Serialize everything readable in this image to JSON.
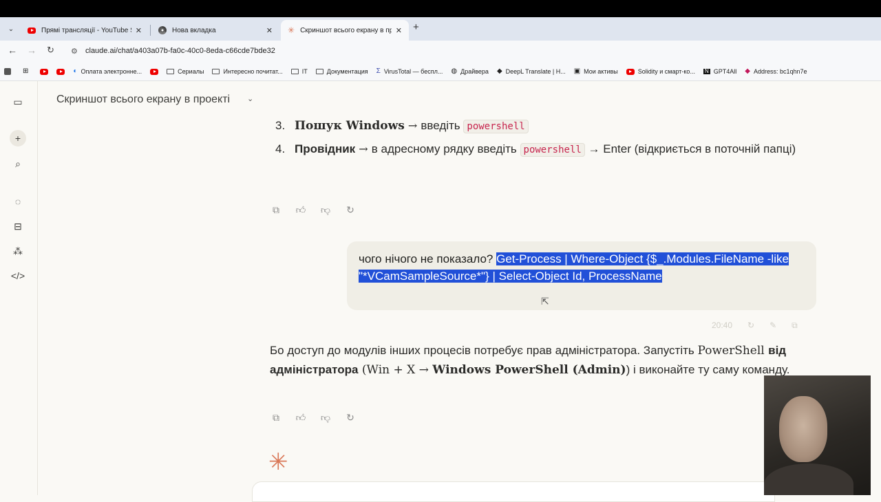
{
  "browser": {
    "tabs": [
      {
        "title": "Прямі трансляції - YouTube Stu",
        "icon": "youtube-icon"
      },
      {
        "title": "Нова вкладка",
        "icon": "chrome-icon"
      },
      {
        "title": "Скриншот всього екрану в пр",
        "icon": "claude-icon"
      }
    ],
    "url": "claude.ai/chat/a403a07b-fa0c-40c0-8eda-c66cde7bde32",
    "bookmarks": [
      {
        "label": "",
        "icon": "youtube-icon"
      },
      {
        "label": "",
        "icon": "youtube-icon"
      },
      {
        "label": "Оплата электронне...",
        "icon": "edge-icon"
      },
      {
        "label": "",
        "icon": "youtube-icon"
      },
      {
        "label": "Сериалы",
        "icon": "folder-icon"
      },
      {
        "label": "Интересно почитат...",
        "icon": "folder-icon"
      },
      {
        "label": "IT",
        "icon": "folder-icon"
      },
      {
        "label": "Документация",
        "icon": "folder-icon"
      },
      {
        "label": "VirusTotal — беспл...",
        "icon": "virustotal-icon"
      },
      {
        "label": "Драйвера",
        "icon": "globe-icon"
      },
      {
        "label": "DeepL Translate | H...",
        "icon": "deepl-icon"
      },
      {
        "label": "Мои активы",
        "icon": "grid-icon"
      },
      {
        "label": "Solidity и смарт-ко...",
        "icon": "youtube-icon"
      },
      {
        "label": "GPT4All",
        "icon": "n-icon"
      },
      {
        "label": "Address: bc1qhn7e",
        "icon": "gem-icon"
      }
    ]
  },
  "project": {
    "title": "Скриншот всього екрану в проекті"
  },
  "list": [
    {
      "num": "3.",
      "bold": "Пошук Windows",
      "arrow": " → ",
      "text": "введіть ",
      "code": "powershell"
    },
    {
      "num": "4.",
      "bold": "Провідник",
      "arrow": " → ",
      "text": "в адресному рядку введіть ",
      "code": "powershell",
      "after": " → Enter (відкриється в поточній папці)"
    }
  ],
  "user_message": {
    "plain": "чого нічого не показало? ",
    "selected": "Get-Process | Where-Object {$_.Modules.FileName -like \"*VCamSampleSource*\"} | Select-Object Id, ProcessName"
  },
  "message_time": "20:40",
  "answer": {
    "p1": "Бо доступ до модулів інших процесів потребує прав адміністратора. Запустіть ",
    "p2": "PowerShell ",
    "p3": "від адміністратора",
    "p4": " (Win + X → ",
    "p5": "Windows PowerShell (Admin)",
    "p6": ") і виконайте ту саму команду."
  }
}
